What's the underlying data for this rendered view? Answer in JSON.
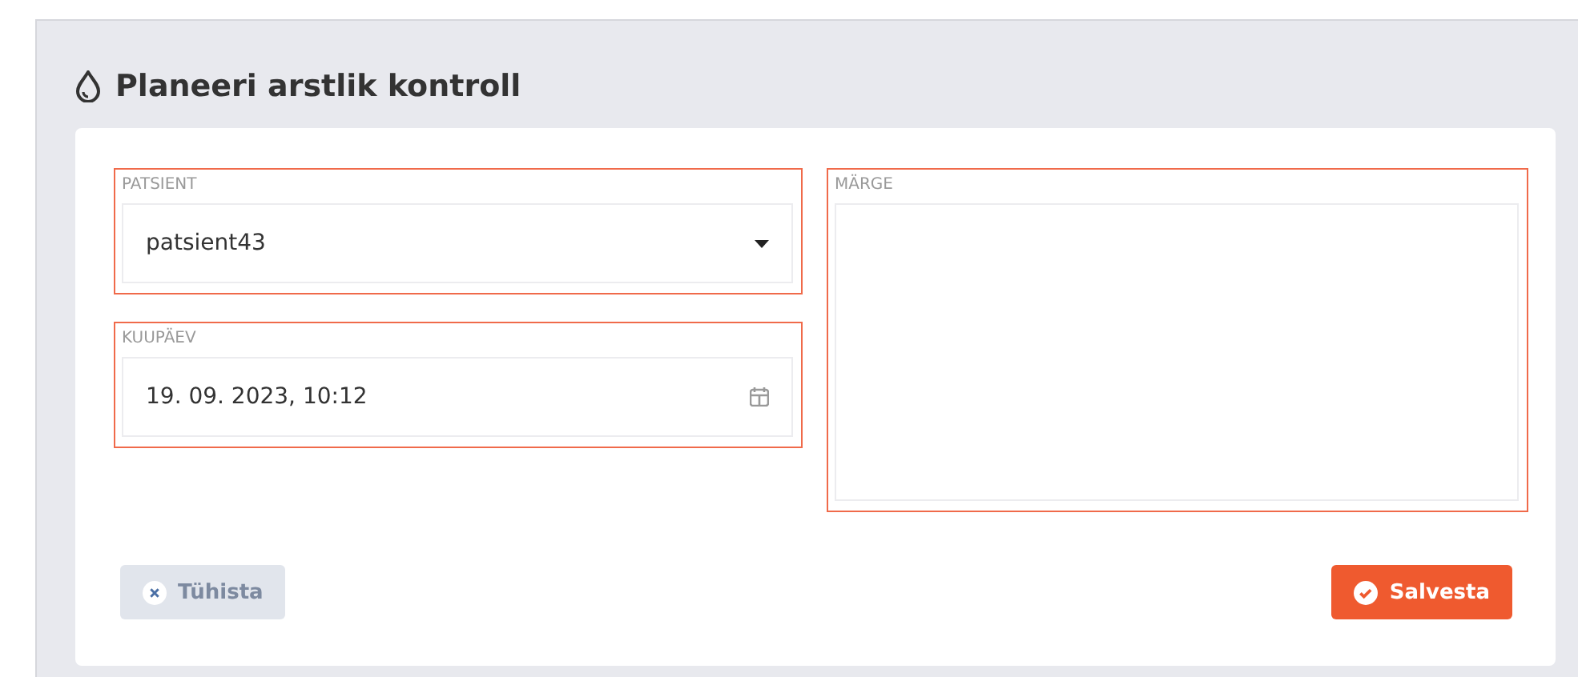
{
  "title": "Planeeri arstlik kontroll",
  "fields": [
    {
      "kind": "select",
      "label": "PATSIENT",
      "value": "patsient43",
      "highlighted": true
    },
    {
      "kind": "datetime",
      "label": "KUUPÄEV",
      "value": "19. 09. 2023, 10:12",
      "highlighted": true
    },
    {
      "kind": "textarea",
      "label": "MÄRGE",
      "highlighted": true
    }
  ],
  "buttons": [
    {
      "kind": "cancel",
      "label": "Tühista",
      "disabled": true
    },
    {
      "kind": "save",
      "label": "Salvesta",
      "disabled": false
    }
  ]
}
